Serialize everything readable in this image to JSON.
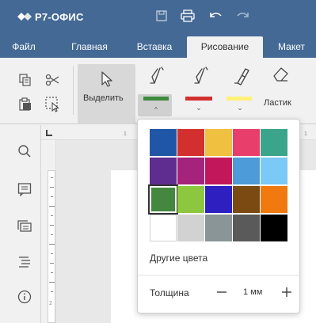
{
  "app": {
    "title": "Р7-ОФИС"
  },
  "menu": {
    "tabs": [
      {
        "label": "Файл"
      },
      {
        "label": "Главная"
      },
      {
        "label": "Вставка"
      },
      {
        "label": "Рисование",
        "active": true
      },
      {
        "label": "Макет"
      }
    ]
  },
  "ribbon": {
    "select_label": "Выделить",
    "eraser_label": "Ластик",
    "pens": [
      {
        "icon": "pen-icon",
        "color": "#3d8b3d"
      },
      {
        "icon": "pen-icon",
        "color": "#d32f2f"
      },
      {
        "icon": "highlighter-icon",
        "color": "#fff176"
      }
    ]
  },
  "sidebar": {
    "icons": [
      "search-icon",
      "comment-icon",
      "chat-icon",
      "navigation-icon",
      "info-icon"
    ]
  },
  "ruler": {
    "top_marks": [
      "1",
      "1"
    ],
    "left_marks": [
      "2"
    ]
  },
  "color_picker": {
    "colors": [
      [
        "#2056a6",
        "#d32f2f",
        "#f0c040",
        "#e83e6c",
        "#3aa58a"
      ],
      [
        "#5e2d8f",
        "#a5237a",
        "#c2185b",
        "#4d9bd8",
        "#7bc9f6"
      ],
      [
        "#43883e",
        "#8dc63f",
        "#2d1fc0",
        "#7b4a12",
        "#f07a0f"
      ],
      [
        "#ffffff",
        "#d2d2d2",
        "#8a9598",
        "#5a5a5a",
        "#000000"
      ]
    ],
    "selected": "#43883e",
    "more_colors_label": "Другие цвета",
    "thickness_label": "Толщина",
    "thickness_value": "1 мм"
  }
}
